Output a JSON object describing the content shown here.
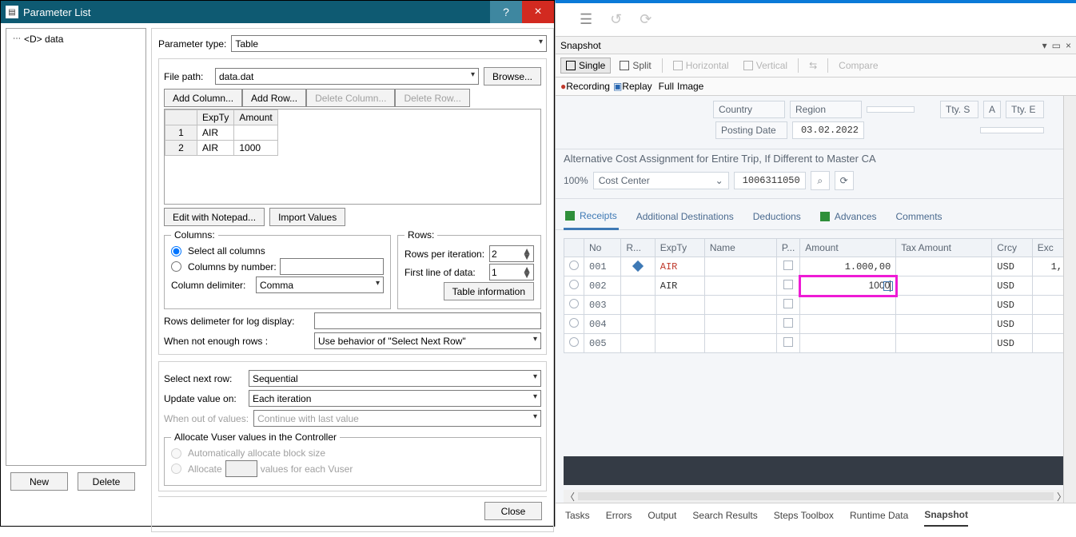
{
  "dialog": {
    "title": "Parameter List",
    "help": "?",
    "close": "×",
    "tree_item": "<D> data",
    "param_type_label": "Parameter type:",
    "param_type_value": "Table",
    "file_path_label": "File path:",
    "file_path_value": "data.dat",
    "browse": "Browse...",
    "add_column": "Add Column...",
    "add_row": "Add Row...",
    "delete_column": "Delete Column...",
    "delete_row": "Delete Row...",
    "grid": {
      "headers": [
        "ExpTy",
        "Amount"
      ],
      "rows": [
        [
          "1",
          "AIR",
          ""
        ],
        [
          "2",
          "AIR",
          "1000"
        ]
      ]
    },
    "edit_notepad": "Edit with Notepad...",
    "import_values": "Import Values",
    "columns_legend": "Columns:",
    "select_all_cols": "Select all columns",
    "cols_by_number": "Columns by number:",
    "col_delimiter": "Column delimiter:",
    "col_delim_value": "Comma",
    "rows_legend": "Rows:",
    "rows_per_iter": "Rows per iteration:",
    "rows_per_iter_value": "2",
    "first_line": "First line of data:",
    "first_line_value": "1",
    "table_info": "Table information",
    "rows_delim": "Rows delimeter for log display:",
    "not_enough": "When not enough rows :",
    "not_enough_value": "Use behavior of \"Select Next Row\"",
    "select_next_row": "Select next row:",
    "select_next_row_value": "Sequential",
    "update_on": "Update value on:",
    "update_on_value": "Each iteration",
    "out_of_values": "When out of values:",
    "out_of_values_value": "Continue with last value",
    "alloc_legend": "Allocate Vuser values in the Controller",
    "alloc_auto": "Automatically allocate block size",
    "alloc_manual": "Allocate",
    "alloc_suffix": "values for each Vuser",
    "new_btn": "New",
    "delete_btn": "Delete",
    "close_btn": "Close"
  },
  "right": {
    "snapshot": "Snapshot",
    "single": "Single",
    "split": "Split",
    "horizontal": "Horizontal",
    "vertical": "Vertical",
    "compare": "Compare",
    "recording": "Recording",
    "replay": "Replay",
    "full": "Full",
    "image": "Image",
    "country": "Country",
    "region": "Region",
    "tty_s": "Tty. S",
    "a": "A",
    "tty_e": "Tty. E",
    "posting_date": "Posting Date",
    "posting_date_value": "03.02.2022",
    "alt_cost": "Alternative Cost Assignment for Entire Trip, If Different to Master CA",
    "pct": "100%",
    "cost_center": "Cost Center",
    "cost_center_value": "1006311050",
    "tabs": {
      "receipts": "Receipts",
      "add_dest": "Additional Destinations",
      "deductions": "Deductions",
      "advances": "Advances",
      "comments": "Comments"
    },
    "table": {
      "headers": [
        "No",
        "R...",
        "ExpTy",
        "Name",
        "P...",
        "Amount",
        "Tax Amount",
        "Crcy",
        "Exc"
      ],
      "rows": [
        {
          "no": "001",
          "expty": "AIR",
          "amount": "1.000,00",
          "crcy": "USD",
          "exc": "1,",
          "marked": true
        },
        {
          "no": "002",
          "expty": "AIR",
          "amount": "1000",
          "crcy": "USD",
          "highlighted": true
        },
        {
          "no": "003",
          "crcy": "USD"
        },
        {
          "no": "004",
          "crcy": "USD"
        },
        {
          "no": "005",
          "crcy": "USD"
        }
      ]
    },
    "bottom_tabs": [
      "Tasks",
      "Errors",
      "Output",
      "Search Results",
      "Steps Toolbox",
      "Runtime Data",
      "Snapshot"
    ],
    "bottom_active": "Snapshot"
  }
}
